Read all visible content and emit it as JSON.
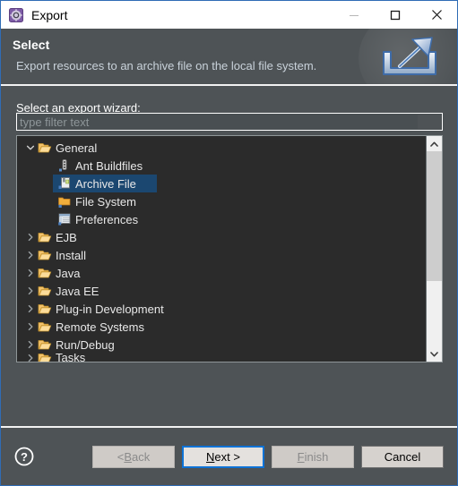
{
  "window": {
    "title": "Export",
    "icon": "eclipse-export-icon",
    "border_color": "#2f6cb5",
    "titlebar_bg": "#ffffff",
    "body_bg": "#4e5356",
    "controls": [
      {
        "name": "minimize",
        "glyph": "minimize-icon",
        "enabled": false
      },
      {
        "name": "maximize",
        "glyph": "maximize-icon",
        "enabled": true
      },
      {
        "name": "close",
        "glyph": "close-icon",
        "enabled": true
      }
    ]
  },
  "header": {
    "title": "Select",
    "description": "Export resources to an archive file on the local file system.",
    "banner_icon": "export-arrow-tray-icon"
  },
  "main": {
    "field_label_prefix": "S",
    "field_label_rest": "elect an export wizard:",
    "filter": {
      "placeholder": "type filter text",
      "value": ""
    },
    "tree": {
      "selected": "Archive File",
      "selection_color": "#1b4770",
      "background": "#2b2b2b",
      "rows": [
        {
          "label": "General",
          "depth": 0,
          "icon": "folder-open-icon",
          "twisty": "chevron-down-icon",
          "expanded": true,
          "selected": false
        },
        {
          "label": "Ant Buildfiles",
          "depth": 1,
          "icon": "ant-buildfile-icon",
          "twisty": "",
          "expanded": false,
          "selected": false
        },
        {
          "label": "Archive File",
          "depth": 1,
          "icon": "archive-file-icon",
          "twisty": "",
          "expanded": false,
          "selected": true
        },
        {
          "label": "File System",
          "depth": 1,
          "icon": "file-system-icon",
          "twisty": "",
          "expanded": false,
          "selected": false
        },
        {
          "label": "Preferences",
          "depth": 1,
          "icon": "preferences-icon",
          "twisty": "",
          "expanded": false,
          "selected": false
        },
        {
          "label": "EJB",
          "depth": 0,
          "icon": "folder-open-icon",
          "twisty": "chevron-right-icon",
          "expanded": false,
          "selected": false
        },
        {
          "label": "Install",
          "depth": 0,
          "icon": "folder-open-icon",
          "twisty": "chevron-right-icon",
          "expanded": false,
          "selected": false
        },
        {
          "label": "Java",
          "depth": 0,
          "icon": "folder-open-icon",
          "twisty": "chevron-right-icon",
          "expanded": false,
          "selected": false
        },
        {
          "label": "Java EE",
          "depth": 0,
          "icon": "folder-open-icon",
          "twisty": "chevron-right-icon",
          "expanded": false,
          "selected": false
        },
        {
          "label": "Plug-in Development",
          "depth": 0,
          "icon": "folder-open-icon",
          "twisty": "chevron-right-icon",
          "expanded": false,
          "selected": false
        },
        {
          "label": "Remote Systems",
          "depth": 0,
          "icon": "folder-open-icon",
          "twisty": "chevron-right-icon",
          "expanded": false,
          "selected": false
        },
        {
          "label": "Run/Debug",
          "depth": 0,
          "icon": "folder-open-icon",
          "twisty": "chevron-right-icon",
          "expanded": false,
          "selected": false
        },
        {
          "label": "Tasks",
          "depth": 0,
          "icon": "folder-open-icon",
          "twisty": "chevron-right-icon",
          "expanded": false,
          "selected": false,
          "clipped": true
        }
      ]
    },
    "scrollbar": {
      "up_arrow": "chevron-up-icon",
      "down_arrow": "chevron-down-icon"
    }
  },
  "footer": {
    "help_icon": "help-question-icon",
    "buttons": [
      {
        "name": "back",
        "label": "< Back",
        "mnemonic": "B",
        "enabled": false,
        "default": false
      },
      {
        "name": "next",
        "label": "Next >",
        "mnemonic": "N",
        "enabled": true,
        "default": true
      },
      {
        "name": "finish",
        "label": "Finish",
        "mnemonic": "F",
        "enabled": false,
        "default": false
      },
      {
        "name": "cancel",
        "label": "Cancel",
        "mnemonic": "",
        "enabled": true,
        "default": false
      }
    ]
  }
}
